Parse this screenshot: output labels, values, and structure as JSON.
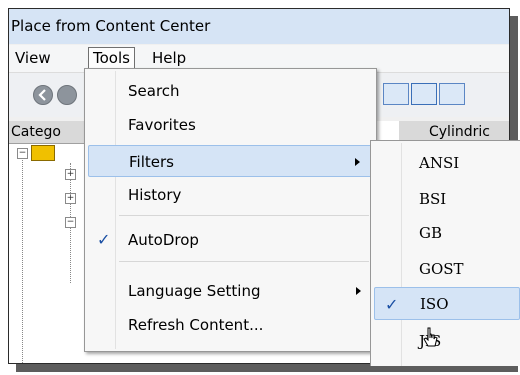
{
  "window": {
    "title": "Place from Content Center"
  },
  "menubar": {
    "items": [
      {
        "label": "View"
      },
      {
        "label": "Tools"
      },
      {
        "label": "Help"
      }
    ]
  },
  "left_pane": {
    "header": "Catego"
  },
  "right_pane": {
    "header": "Cylindric"
  },
  "tools_menu": {
    "items": [
      {
        "label": "Search"
      },
      {
        "label": "Favorites"
      },
      {
        "label": "Filters"
      },
      {
        "label": "History"
      },
      {
        "label": "AutoDrop",
        "checked": true
      },
      {
        "label": "Language Setting"
      },
      {
        "label": "Refresh Content..."
      }
    ]
  },
  "filters_submenu": {
    "items": [
      {
        "label": "ANSI"
      },
      {
        "label": "BSI"
      },
      {
        "label": "GB"
      },
      {
        "label": "GOST"
      },
      {
        "label": "ISO",
        "checked": true
      },
      {
        "label": "JIS"
      }
    ]
  },
  "icons": {
    "check": "check-icon",
    "submenu_arrow": "chevron-right-icon",
    "back": "back-icon",
    "forward": "forward-icon",
    "cursor": "mouse-pointer-icon"
  },
  "colors": {
    "highlight": "#d5e4f6",
    "check": "#1a4fa3",
    "titlebar": "#d6e4f5"
  }
}
